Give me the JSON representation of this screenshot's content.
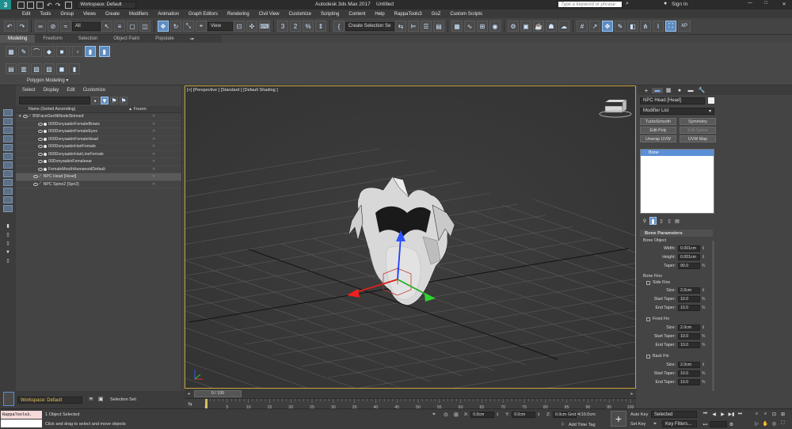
{
  "title_bar": {
    "workspace_label": "Workspace: Default",
    "app_title": "Autodesk 3ds Max 2017",
    "file_title": "Untitled",
    "search_placeholder": "Type a keyword or phrase",
    "sign_in": "Sign In"
  },
  "menu": [
    "Edit",
    "Tools",
    "Group",
    "Views",
    "Create",
    "Modifiers",
    "Animation",
    "Graph Editors",
    "Rendering",
    "Civil View",
    "Customize",
    "Scripting",
    "Content",
    "Help",
    "RappaTools3",
    "GoZ",
    "Custom Scripts"
  ],
  "toolbar": {
    "filter_value": "All",
    "ref_coord_value": "View",
    "named_selection_value": "Create Selection Se",
    "snap_number": "3",
    "snap_angle": "2",
    "xp_label": "XP"
  },
  "ribbon": {
    "tabs": [
      "Modeling",
      "Freeform",
      "Selection",
      "Object Paint",
      "Populate"
    ],
    "panel_label": "Polygon Modeling"
  },
  "scene_explorer": {
    "menu": [
      "Select",
      "Display",
      "Edit",
      "Customize"
    ],
    "column_name": "Name (Sorted Ascending)",
    "column_frozen": "▲ Frozen",
    "rows": [
      {
        "label": "BSFaceGenNiNodeSkinned",
        "indent": 0,
        "selected": false
      },
      {
        "label": "000DonyaakinFemaleBrows",
        "indent": 1,
        "selected": false
      },
      {
        "label": "000DonyaakinFemaleEyes",
        "indent": 1,
        "selected": false
      },
      {
        "label": "000DonyaakinFemaleHead",
        "indent": 1,
        "selected": false
      },
      {
        "label": "000DonyaakinHairFemale",
        "indent": 1,
        "selected": false
      },
      {
        "label": "000DonyaakinHairLineFemale",
        "indent": 1,
        "selected": false
      },
      {
        "label": "00DonyaakinFemaleear",
        "indent": 1,
        "selected": false
      },
      {
        "label": "FemaleMouthHumanoidDefault",
        "indent": 1,
        "selected": false
      },
      {
        "label": "NPC Head [Head]",
        "indent": 0,
        "selected": true
      },
      {
        "label": "NPC Spine2 [Spn2]",
        "indent": 0,
        "selected": false
      }
    ]
  },
  "viewport": {
    "label": "[+] [Perspective ] [Standard ] [Default Shading ]"
  },
  "command_panel": {
    "object_name": "NPC Head [Head]",
    "modifier_list": "Modifier List",
    "mod_buttons": [
      {
        "label": "TurboSmooth",
        "enabled": true
      },
      {
        "label": "Symmetry",
        "enabled": true
      },
      {
        "label": "Edit Poly",
        "enabled": true
      },
      {
        "label": "Edit Spline",
        "enabled": false
      },
      {
        "label": "Unwrap UVW",
        "enabled": true
      },
      {
        "label": "UVW Map",
        "enabled": true
      }
    ],
    "stack_item": "Bone",
    "rollout_title": "Bone Parameters",
    "bone_object_group": "Bone Object",
    "width_label": "Width:",
    "width_value": "0.001cm",
    "height_label": "Height:",
    "height_value": "0.001cm",
    "taper_label": "Taper:",
    "taper_value": "90.0",
    "bone_fins_group": "Bone Fins",
    "side_fins": "Side Fins",
    "front_fin": "Front Fin",
    "back_fin": "Back Fin",
    "size_label": "Size:",
    "start_taper_label": "Start Taper:",
    "end_taper_label": "End Taper:",
    "size_value": "2.0cm",
    "taper_fin_value": "10.0",
    "percent": "%"
  },
  "timeline": {
    "frame_label": "0 / 100",
    "ticks": [
      "0",
      "5",
      "10",
      "15",
      "20",
      "25",
      "30",
      "35",
      "40",
      "45",
      "50",
      "55",
      "60",
      "65",
      "70",
      "75",
      "80",
      "85",
      "90",
      "95",
      "100"
    ]
  },
  "status": {
    "workspace": "Workspace: Default",
    "selection_set": "Selection Set:",
    "maxscript": "RappaTools3.",
    "objects_selected": "1 Object Selected",
    "prompt": "Click and drag to select and move objects",
    "x_label": "X:",
    "x_value": "0.0cm",
    "y_label": "Y:",
    "y_value": "0.0cm",
    "z_label": "Z:",
    "z_value": "0.0cm",
    "grid": "Grid = 10.0cm",
    "add_time_tag": "Add Time Tag",
    "auto_key": "Auto Key",
    "set_key": "Set Key",
    "selected": "Selected",
    "key_filters": "Key Filters..."
  },
  "colors": {
    "accent": "#5e8cc0",
    "viewport_border": "#c8a23a",
    "selection_blue": "#5b8fd6"
  }
}
